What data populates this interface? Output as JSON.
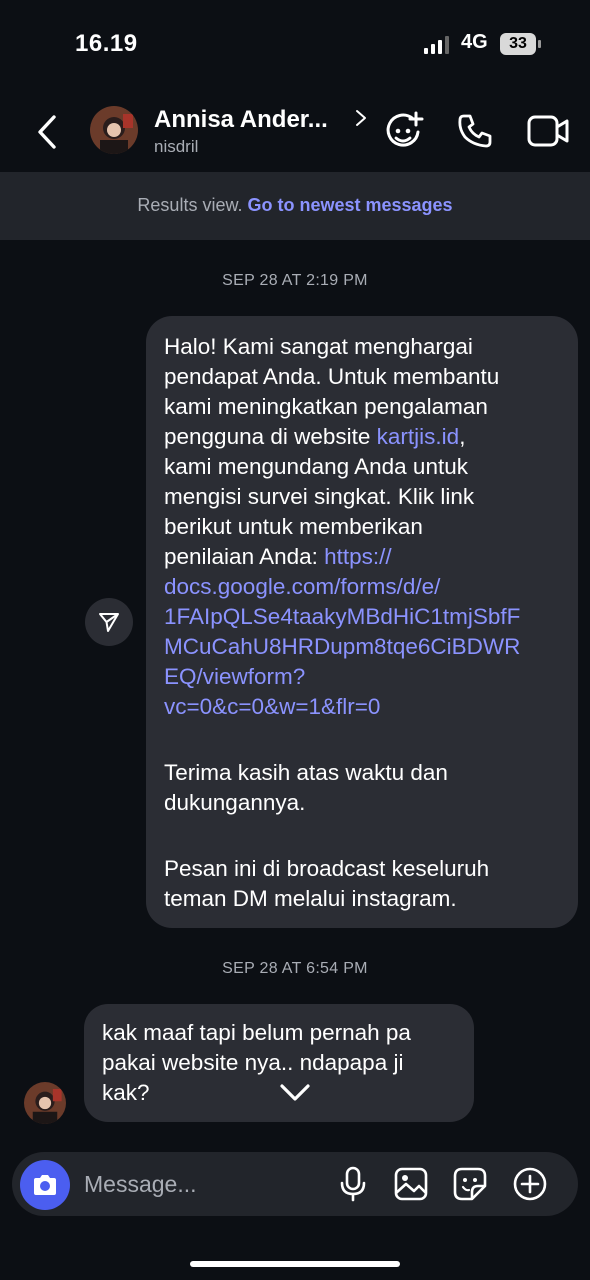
{
  "status_bar": {
    "time": "16.19",
    "network": "4G",
    "battery": "33"
  },
  "header": {
    "contact_name": "Annisa Ander...",
    "username": "nisdril",
    "icons": [
      "back-arrow-icon",
      "effects-icon",
      "phone-icon",
      "video-camera-icon"
    ]
  },
  "banner": {
    "label": "Results view.",
    "link": "Go to newest messages"
  },
  "messages": [
    {
      "timestamp": "SEP 28 AT 2:19 PM",
      "direction": "outgoing",
      "lines": {
        "l1": "Halo! Kami sangat menghargai",
        "l2": "pendapat Anda. Untuk membantu",
        "l3": "kami meningkatkan pengalaman",
        "l4": "pengguna di website ",
        "l4_link": "kartjis.id",
        "l4_end": ",",
        "l5": "kami mengundang Anda untuk",
        "l6": "mengisi survei singkat. Klik link",
        "l7": "berikut untuk memberikan",
        "l8": "penilaian Anda: ",
        "l8_link": "https://",
        "url1": "docs.google.com/forms/d/e/",
        "url2": "1FAIpQLSe4taakyMBdHiC1tmjSbfF",
        "url3": "MCuCahU8HRDupm8tqe6CiBDWR",
        "url4": "EQ/viewform?",
        "url5": "vc=0&c=0&w=1&flr=0",
        "l9": "Terima kasih atas waktu dan",
        "l10": "dukungannya.",
        "l11": "Pesan ini di broadcast keseluruh",
        "l12": "teman DM melalui instagram."
      }
    },
    {
      "timestamp": "SEP 28 AT 6:54 PM",
      "direction": "incoming",
      "lines": {
        "l1": "kak maaf tapi belum pernah pa",
        "l2": "pakai website nya.. ndapapa ji",
        "l3": "kak?"
      }
    }
  ],
  "composer": {
    "placeholder": "Message..."
  },
  "colors": {
    "background": "#0c0f14",
    "bubble": "#2b2d34",
    "link": "#8b93ff",
    "camera": "#4b5ef0"
  }
}
